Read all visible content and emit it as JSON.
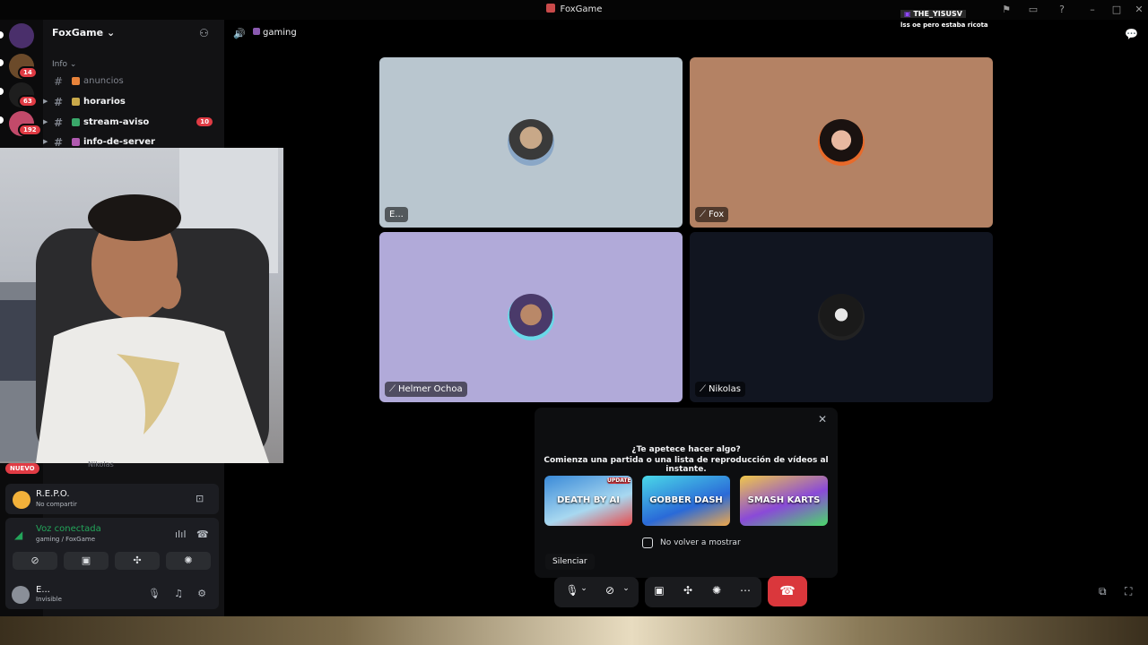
{
  "window": {
    "title": "FoxGame",
    "stream_overlay": {
      "user": "THE_YISUSV",
      "message": "lss oe pero estaba ricota"
    }
  },
  "rail": {
    "badges": [
      "14",
      "63",
      "192"
    ]
  },
  "sidebar": {
    "server_name": "FoxGame",
    "category": "Info",
    "channels": [
      {
        "name": "anuncios",
        "badge": ""
      },
      {
        "name": "horarios",
        "badge": ""
      },
      {
        "name": "stream-aviso",
        "badge": "10"
      },
      {
        "name": "info-de-server",
        "badge": ""
      }
    ]
  },
  "bottom": {
    "new_badge": "NUEVO",
    "ghost_user": "Nikolas",
    "activity": {
      "title": "R.E.P.O.",
      "subtitle": "No compartir"
    },
    "voice": {
      "status": "Voz conectada",
      "channel": "gaming / FoxGame"
    },
    "user": {
      "name": "E...",
      "status": "Invisible"
    }
  },
  "main": {
    "channel_title": "gaming",
    "tiles": [
      {
        "name": "E...",
        "color": "#b9c6cf"
      },
      {
        "name": "Fox",
        "color": "#b48264"
      },
      {
        "name": "Helmer Ochoa",
        "color": "#b1aad9"
      },
      {
        "name": "Nikolas",
        "color": "#111520"
      }
    ]
  },
  "popup": {
    "question": "¿Te apetece hacer algo?",
    "description": "Comienza una partida o una lista de reproducción de vídeos al instante.",
    "games": [
      {
        "label": "DEATH BY AI",
        "badge": "UPDATE"
      },
      {
        "label": "GOBBER DASH",
        "badge": ""
      },
      {
        "label": "SMASH KARTS",
        "badge": ""
      }
    ],
    "checkbox_label": "No volver a mostrar"
  },
  "controls": {
    "tooltip": "Silenciar"
  },
  "icons": {
    "colors": {
      "accent_red": "#da373c",
      "online_green": "#23a55a",
      "badge_red": "#e03b44"
    }
  }
}
